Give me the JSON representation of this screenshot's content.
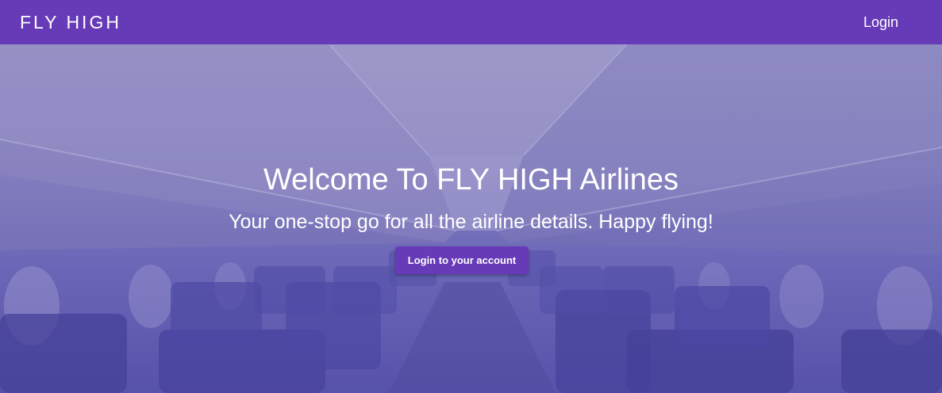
{
  "navbar": {
    "brand": "FLY HIGH",
    "login_label": "Login"
  },
  "hero": {
    "title": "Welcome To FLY HIGH Airlines",
    "subtitle": "Your one-stop go for all the airline details. Happy flying!",
    "button_label": "Login to your account",
    "background_image": "airplane-cabin-interior"
  },
  "colors": {
    "primary": "#673ab7",
    "overlay": "#5c55b0",
    "text": "#ffffff"
  }
}
